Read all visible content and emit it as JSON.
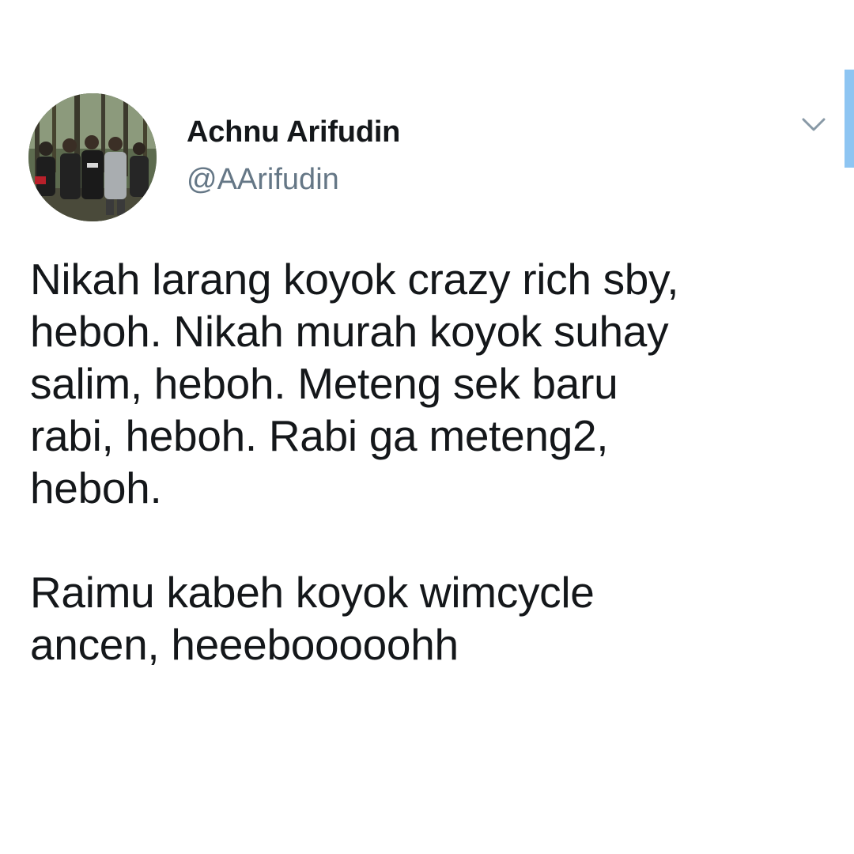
{
  "tweet": {
    "author": {
      "name": "Achnu Arifudin",
      "handle": "@AArifudin"
    },
    "paragraph_1": "Nikah larang koyok crazy rich sby,\nheboh. Nikah murah koyok suhay\nsalim, heboh. Meteng sek baru\nrabi, heboh. Rabi ga meteng2,\nheboh.",
    "paragraph_2": "Raimu kabeh koyok wimcycle\nancen, heeebooooohh"
  },
  "icons": {
    "menu": "chevron-down-icon",
    "avatar": "group-photo-avatar"
  },
  "colors": {
    "text": "#14171a",
    "secondary_text": "#657786",
    "scrollbar_accent": "#8ec5f2",
    "background": "#ffffff"
  }
}
